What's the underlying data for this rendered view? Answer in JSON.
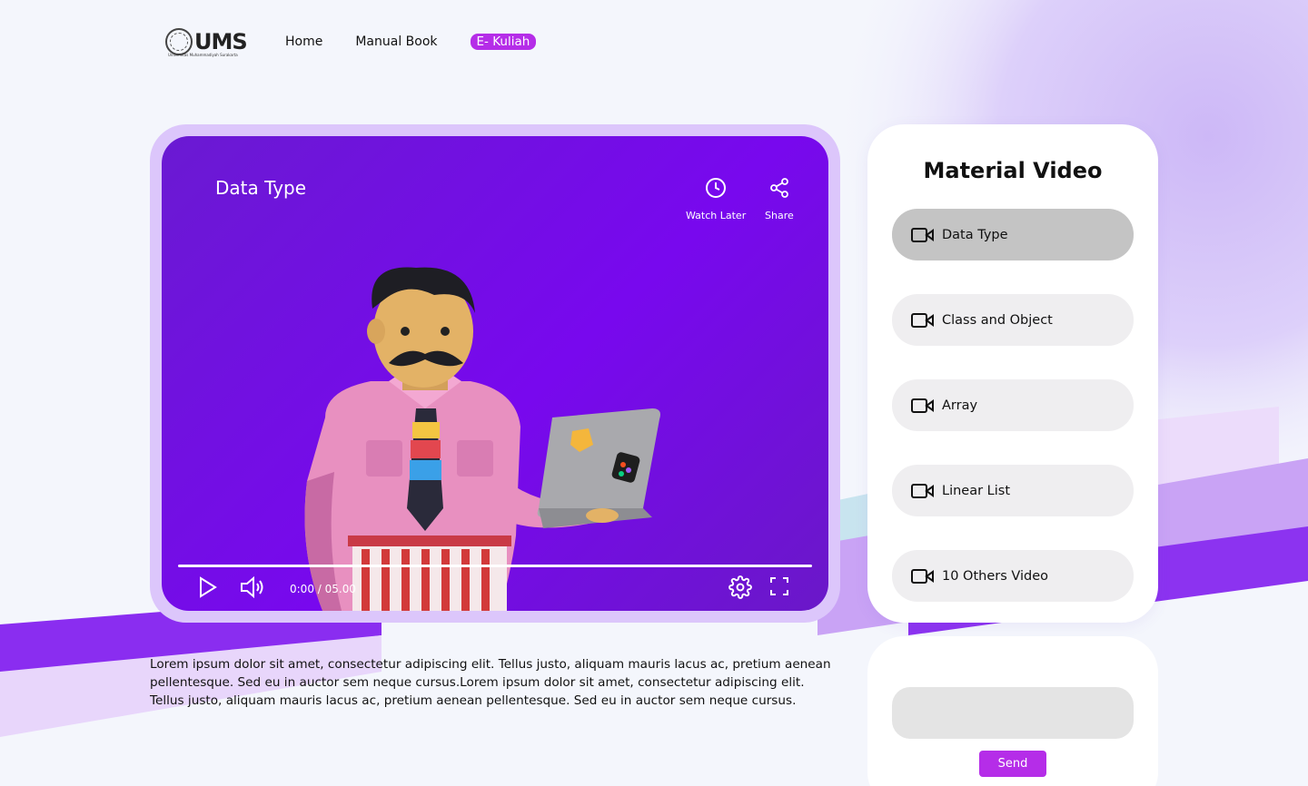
{
  "header": {
    "logo_text": "UMS",
    "logo_sub": "Universitas Muhammadiyah Surakarta",
    "nav": [
      {
        "label": "Home"
      },
      {
        "label": "Manual Book"
      },
      {
        "label": "E- Kuliah"
      }
    ]
  },
  "video": {
    "title": "Data Type",
    "watch_later_label": "Watch Later",
    "share_label": "Share",
    "time": "0:00 / 05.00",
    "icons": [
      "clock-icon",
      "share-icon",
      "play-icon",
      "volume-icon",
      "gear-icon",
      "fullscreen-icon"
    ]
  },
  "description": "Lorem ipsum dolor sit amet, consectetur adipiscing elit. Tellus justo, aliquam mauris lacus ac, pretium aenean pellentesque. Sed eu in auctor sem neque cursus.Lorem ipsum dolor sit amet, consectetur adipiscing elit. Tellus justo, aliquam mauris lacus ac, pretium aenean pellentesque. Sed eu in auctor sem neque cursus.",
  "material": {
    "title": "Material Video",
    "items": [
      {
        "label": "Data Type",
        "selected": true
      },
      {
        "label": "Class and Object",
        "selected": false
      },
      {
        "label": "Array",
        "selected": false
      },
      {
        "label": "Linear List",
        "selected": false
      },
      {
        "label": "10 Others Video",
        "selected": false
      }
    ]
  },
  "comment": {
    "placeholder": "",
    "send_label": "Send"
  },
  "colors": {
    "accent": "#b52de8",
    "video_bg": "#7808ee",
    "frame": "#dcc6fb",
    "selected_item": "#c4c4c4",
    "item_bg": "#efeef0"
  }
}
